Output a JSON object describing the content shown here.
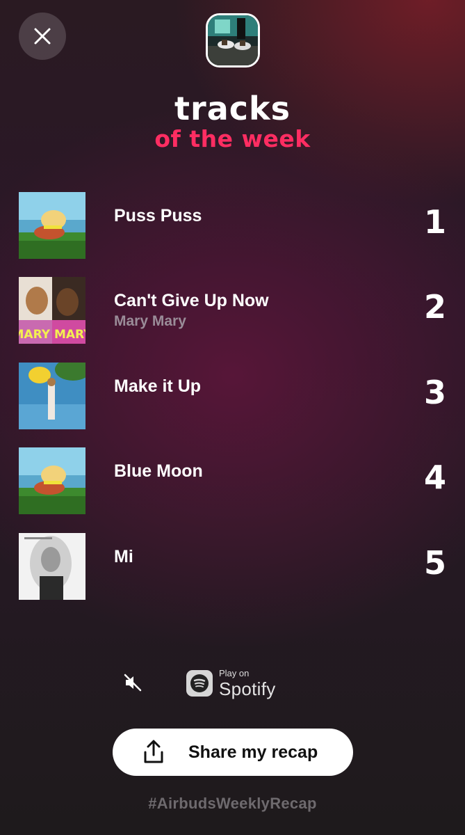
{
  "header": {
    "close_icon": "close-icon",
    "avatar_icon": "profile-avatar"
  },
  "heading": {
    "title": "tracks",
    "subtitle": "of the week",
    "subtitle_color": "#ff2d62"
  },
  "tracks": [
    {
      "rank": "1",
      "title": "Puss Puss",
      "artist": ""
    },
    {
      "rank": "2",
      "title": "Can't Give Up Now",
      "artist": "Mary Mary",
      "cover_text": "MARY MARY"
    },
    {
      "rank": "3",
      "title": "Make it Up",
      "artist": ""
    },
    {
      "rank": "4",
      "title": "Blue Moon",
      "artist": ""
    },
    {
      "rank": "5",
      "title": "Mi",
      "artist": ""
    }
  ],
  "controls": {
    "mute_icon": "speaker-muted-icon",
    "spotify_small": "Play on",
    "spotify_big": "Spotify"
  },
  "share": {
    "label": "Share my recap",
    "icon": "share-icon"
  },
  "hashtag": "#AirbudsWeeklyRecap"
}
